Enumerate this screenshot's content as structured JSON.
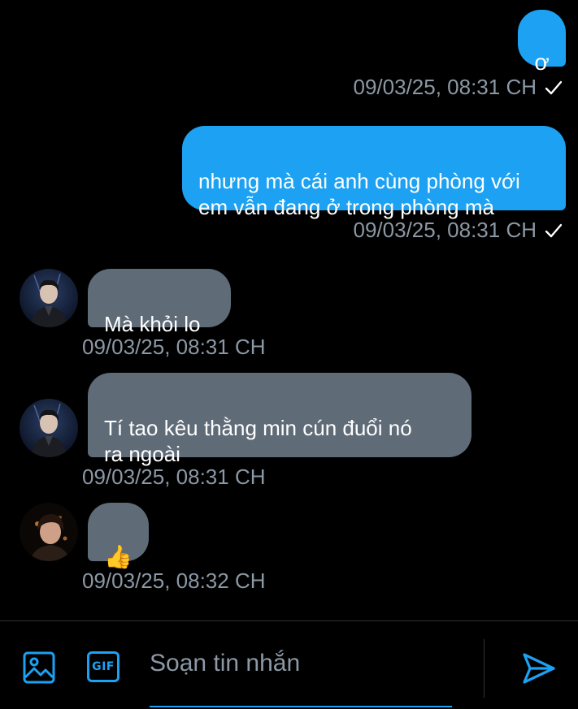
{
  "messages": [
    {
      "direction": "outgoing",
      "text": "ơ",
      "timestamp": "09/03/25, 08:31 CH",
      "status": "sent"
    },
    {
      "direction": "outgoing",
      "text": "nhưng mà cái anh cùng phòng với\nem vẫn đang ở trong phòng mà",
      "timestamp": "09/03/25, 08:31 CH",
      "status": "sent"
    },
    {
      "direction": "incoming",
      "text": "Mà khỏi lo",
      "timestamp": "09/03/25, 08:31 CH",
      "avatar": "avatar-person-a"
    },
    {
      "direction": "incoming",
      "text": "Tí tao kêu thằng min cún đuổi nó\nra ngoài",
      "timestamp": "09/03/25, 08:31 CH",
      "avatar": "avatar-person-a"
    },
    {
      "direction": "incoming",
      "text": "👍",
      "timestamp": "09/03/25, 08:32 CH",
      "avatar": "avatar-person-b"
    }
  ],
  "composer": {
    "placeholder": "Soạn tin nhắn",
    "value": "",
    "gif_label": "GIF",
    "icons": [
      "image-icon",
      "gif-icon",
      "send-icon"
    ]
  },
  "colors": {
    "background": "#000000",
    "outgoing_bubble": "#1da1f2",
    "incoming_bubble": "#5f6b77",
    "timestamp": "#8b98a5",
    "accent": "#1da1f2"
  }
}
